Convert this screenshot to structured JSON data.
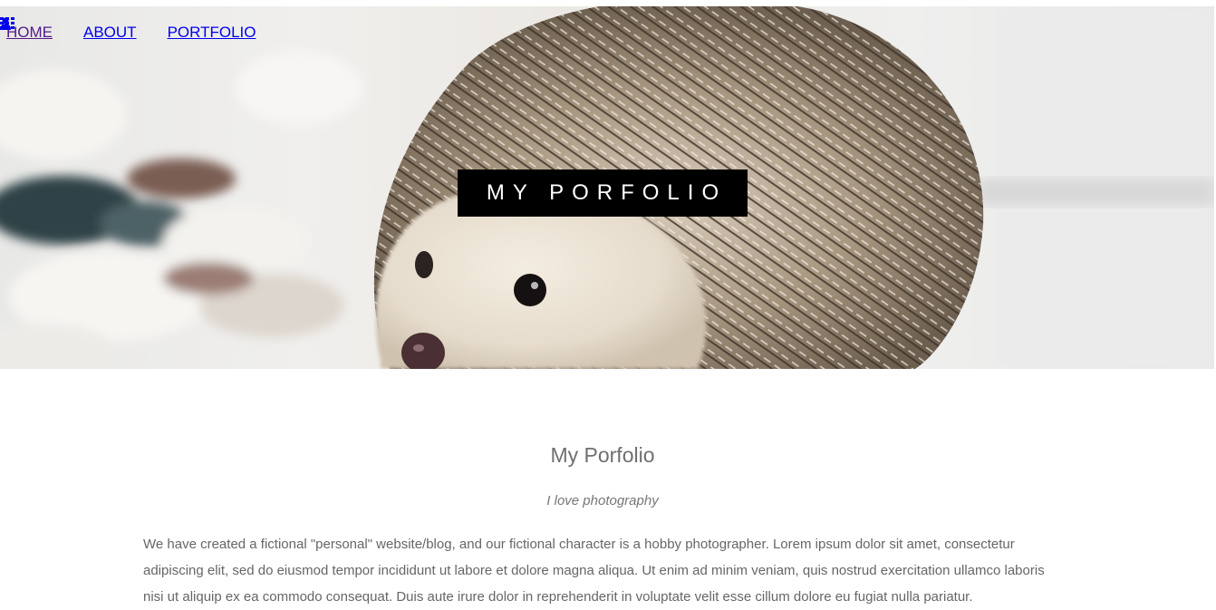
{
  "nav": {
    "items": [
      {
        "label": "HOME",
        "icon": "none"
      },
      {
        "label": "ABOUT",
        "icon": "user-icon"
      },
      {
        "label": "PORTFOLIO",
        "icon": "grid-icon"
      }
    ]
  },
  "hero": {
    "title": "MY PORFOLIO",
    "image": "hedgehog-photo"
  },
  "content": {
    "heading": "My Porfolio",
    "subtitle": "I love photography",
    "paragraph": "We have created a fictional \"personal\" website/blog, and our fictional character is a hobby photographer. Lorem ipsum dolor sit amet, consectetur adipiscing elit, sed do eiusmod tempor incididunt ut labore et dolore magna aliqua. Ut enim ad minim veniam, quis nostrud exercitation ullamco laboris nisi ut aliquip ex ea commodo consequat. Duis aute irure dolor in reprehenderit in voluptate velit esse cillum dolore eu fugiat nulla pariatur."
  },
  "colors": {
    "link": "#0000ee",
    "visited_link": "#551a8b",
    "title_box": "#000000",
    "body_text": "#666666"
  }
}
